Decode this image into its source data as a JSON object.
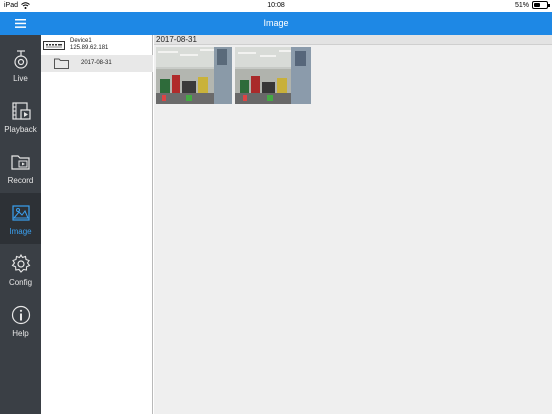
{
  "status_bar": {
    "carrier": "iPad",
    "time": "10:08",
    "battery": "51%",
    "battery_level": 0.51
  },
  "header": {
    "title": "Image"
  },
  "sidebar": {
    "items": [
      {
        "label": "Live",
        "icon": "camera-icon",
        "active": false
      },
      {
        "label": "Playback",
        "icon": "playback-icon",
        "active": false
      },
      {
        "label": "Record",
        "icon": "record-folder-icon",
        "active": false
      },
      {
        "label": "Image",
        "icon": "image-icon",
        "active": true
      },
      {
        "label": "Config",
        "icon": "gear-icon",
        "active": false
      },
      {
        "label": "Help",
        "icon": "info-icon",
        "active": false
      }
    ]
  },
  "tree": {
    "device": {
      "name": "Device1",
      "ip": "125.89.62.181"
    },
    "folder": {
      "label": "2017-08-31"
    }
  },
  "content": {
    "date_header": "2017-08-31",
    "thumbnails": [
      {
        "name": "snapshot-1"
      },
      {
        "name": "snapshot-2"
      }
    ]
  },
  "colors": {
    "accent": "#1e88e5",
    "sidebar_bg": "#3a3f45",
    "active_label": "#3aa0f0"
  }
}
